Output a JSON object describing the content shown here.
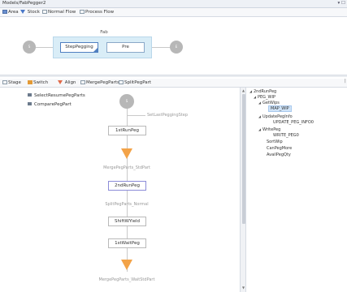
{
  "window": {
    "title": "Models/FabPegger2",
    "controls": "▾ ☐"
  },
  "toolbar1": {
    "items": [
      {
        "label": "Area",
        "icon": "area-icon",
        "color": "#6a8fd0"
      },
      {
        "label": "Stock",
        "icon": "stock-icon",
        "color": "#4a78c8"
      },
      {
        "label": "Normal Flow",
        "icon": "normal-flow-icon",
        "color": "#8a9aa8"
      },
      {
        "label": "Process Flow",
        "icon": "process-flow-icon",
        "color": "#8a9aa8"
      }
    ]
  },
  "fab": {
    "label": "Fab",
    "steps": [
      "StepPegging",
      "Pre"
    ],
    "nodes": [
      "S",
      "E"
    ]
  },
  "toolbar2": {
    "items": [
      {
        "label": "Stage",
        "icon": "stage-icon",
        "color": "#8a9aa8"
      },
      {
        "label": "Switch",
        "icon": "switch-icon",
        "color": "#e39a36"
      },
      {
        "label": "Align",
        "icon": "align-icon",
        "color": "#e06a4a"
      },
      {
        "label": "MergePegParts",
        "icon": "merge-peg-parts-icon",
        "color": "#8a9aa8"
      },
      {
        "label": "SplitPegPart",
        "icon": "split-peg-part-icon",
        "color": "#8a9aa8"
      }
    ]
  },
  "legend": [
    "SelectResumePegParts",
    "ComparePegPart"
  ],
  "flow": {
    "start_node": "S",
    "side_label": "SetLastPeggingStep",
    "nodes": [
      "1stRunPeg",
      "2ndRunPeg",
      "ShiftWYield",
      "1stWaitPeg"
    ],
    "part_labels": [
      "MergePegParts_StdPart",
      "SplitPegParts_Normal",
      "MergePegParts_WaitStdPart"
    ],
    "accent": "#f3a348"
  },
  "tree": {
    "items": [
      {
        "label": "2ndRunPeg",
        "toggle": "◢",
        "level": 0
      },
      {
        "label": "PEG_WIP",
        "toggle": "◢",
        "level": 1
      },
      {
        "label": "GetWips",
        "toggle": "◢",
        "level": 2
      },
      {
        "label": "MAP_WIP",
        "toggle": "",
        "level": 3,
        "selected": true
      },
      {
        "label": "UpdatePegInfo",
        "toggle": "◢",
        "level": 2
      },
      {
        "label": "UPDATE_PEG_INFO0",
        "toggle": "",
        "level": 3
      },
      {
        "label": "WritePeg",
        "toggle": "◢",
        "level": 2
      },
      {
        "label": "WRITE_PEG0",
        "toggle": "",
        "level": 3
      },
      {
        "label": "SortWip",
        "toggle": "",
        "level": 2
      },
      {
        "label": "CanPegMore",
        "toggle": "",
        "level": 2
      },
      {
        "label": "AvailPegQty",
        "toggle": "",
        "level": 2
      }
    ]
  }
}
